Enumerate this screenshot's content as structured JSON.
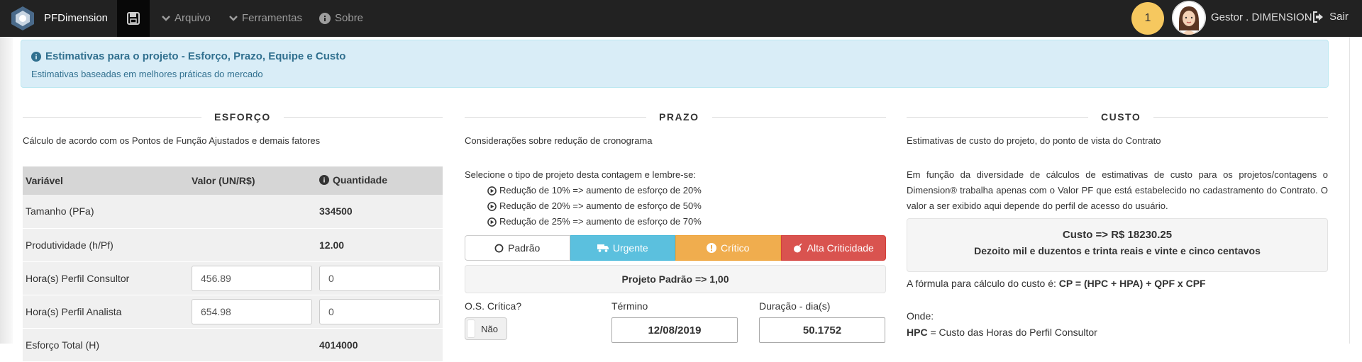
{
  "navbar": {
    "brand": "PFDimension",
    "menu": [
      {
        "label": "Arquivo",
        "icon": "chevron-down-icon"
      },
      {
        "label": "Ferramentas",
        "icon": "chevron-down-icon"
      },
      {
        "label": "Sobre",
        "icon": "info-circle-icon"
      }
    ],
    "notification_count": "1",
    "user_name": "Gestor . DIMENSION",
    "user_dot": ".",
    "logout_label": "Sair"
  },
  "alert": {
    "title": "Estimativas para o projeto - Esforço, Prazo, Equipe e Custo",
    "subtitle": "Estimativas baseadas em melhores práticas do mercado"
  },
  "esforco": {
    "title": "ESFORÇO",
    "description": "Cálculo de acordo com os Pontos de Função Ajustados e demais fatores",
    "headers": {
      "variavel": "Variável",
      "valor": "Valor (UN/R$)",
      "quantidade": "Quantidade"
    },
    "rows": [
      {
        "variavel": "Tamanho (PFa)",
        "valor": "",
        "quantidade": "334500"
      },
      {
        "variavel": "Produtividade (h/Pf)",
        "valor": "",
        "quantidade": "12.00"
      },
      {
        "variavel": "Hora(s) Perfil Consultor",
        "valor": "456.89",
        "quantidade": "0"
      },
      {
        "variavel": "Hora(s) Perfil Analista",
        "valor": "654.98",
        "quantidade": "0"
      },
      {
        "variavel": "Esforço Total (H)",
        "valor": "",
        "quantidade": "4014000"
      }
    ]
  },
  "prazo": {
    "title": "PRAZO",
    "description": "Considerações sobre redução de cronograma",
    "intro": "Selecione o tipo de projeto desta contagem e lembre-se:",
    "items": [
      "Redução de 10% => aumento de esforço de 20%",
      "Redução de 20% => aumento de esforço de 50%",
      "Redução de 25% => aumento de esforço de 70%"
    ],
    "buttons": [
      {
        "label": "Padrão",
        "icon": "circle-outline-icon",
        "color": "#ffffff"
      },
      {
        "label": "Urgente",
        "icon": "truck-icon",
        "color": "#5bc0de"
      },
      {
        "label": "Crítico",
        "icon": "exclamation-circle-icon",
        "color": "#f0ad4e"
      },
      {
        "label": "Alta Criticidade",
        "icon": "bomb-icon",
        "color": "#d9534f"
      }
    ],
    "result": "Projeto Padrão => 1,00",
    "os_critica_label": "O.S. Crítica?",
    "os_critica_value": "Não",
    "termino_label": "Término",
    "termino_value": "12/08/2019",
    "duracao_label": "Duração - dia(s)",
    "duracao_value": "50.1752"
  },
  "custo": {
    "title": "CUSTO",
    "description": "Estimativas de custo do projeto, do ponto de vista do Contrato",
    "paragraph": "Em função da diversidade de cálculos de estimativas de custo para os projetos/contagens o Dimension® trabalha apenas com o Valor PF que está estabelecido no cadastramento do Contrato. O valor a ser exibido aqui depende do perfil de acesso do usuário.",
    "valor_line": "Custo => R$ 18230.25",
    "valor_extenso": "Dezoito mil e duzentos e trinta reais e vinte e cinco centavos",
    "formula_prefix": "A fórmula para cálculo do custo é:",
    "formula": "CP = (HPC + HPA) + QPF x CPF",
    "onde": "Onde:",
    "hpc_term": "HPC",
    "hpc_def": "= Custo das Horas do Perfil Consultor"
  }
}
